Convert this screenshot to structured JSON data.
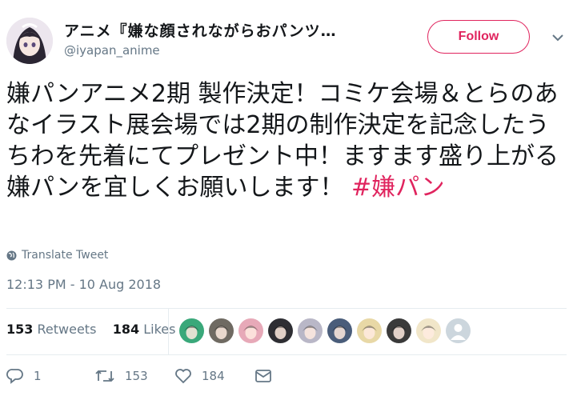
{
  "account": {
    "display_name": "アニメ『嫌な顔されながらおパンツ…",
    "handle": "@iyapan_anime"
  },
  "follow_label": "Follow",
  "tweet": {
    "text": "嫌パンアニメ2期 製作決定！コミケ会場＆とらのあなイラスト展会場では2期の制作決定を記念したうちわを先着にてプレゼント中！ますます盛り上がる嫌パンを宜しくお願いします！",
    "hashtag": "#嫌パン"
  },
  "translate_label": "Translate Tweet",
  "timestamp": "12:13 PM - 10 Aug 2018",
  "stats": {
    "retweets_count": "153",
    "retweets_label": "Retweets",
    "likes_count": "184",
    "likes_label": "Likes"
  },
  "likers": [
    {
      "color": "#3aa87a"
    },
    {
      "color": "#6f6a62"
    },
    {
      "color": "#e7a9b8"
    },
    {
      "color": "#2e2e33"
    },
    {
      "color": "#b9b7c7"
    },
    {
      "color": "#4a5d7a"
    },
    {
      "color": "#e8d8a6"
    },
    {
      "color": "#3a3a3a"
    },
    {
      "color": "#f1e6c9"
    },
    {
      "color": "#ccd6dd"
    }
  ],
  "actions": {
    "reply_count": "1",
    "retweet_count": "153",
    "like_count": "184"
  },
  "colors": {
    "accent": "#e0245e",
    "muted": "#657786",
    "text": "#14171a",
    "divider": "#e6ecf0"
  }
}
